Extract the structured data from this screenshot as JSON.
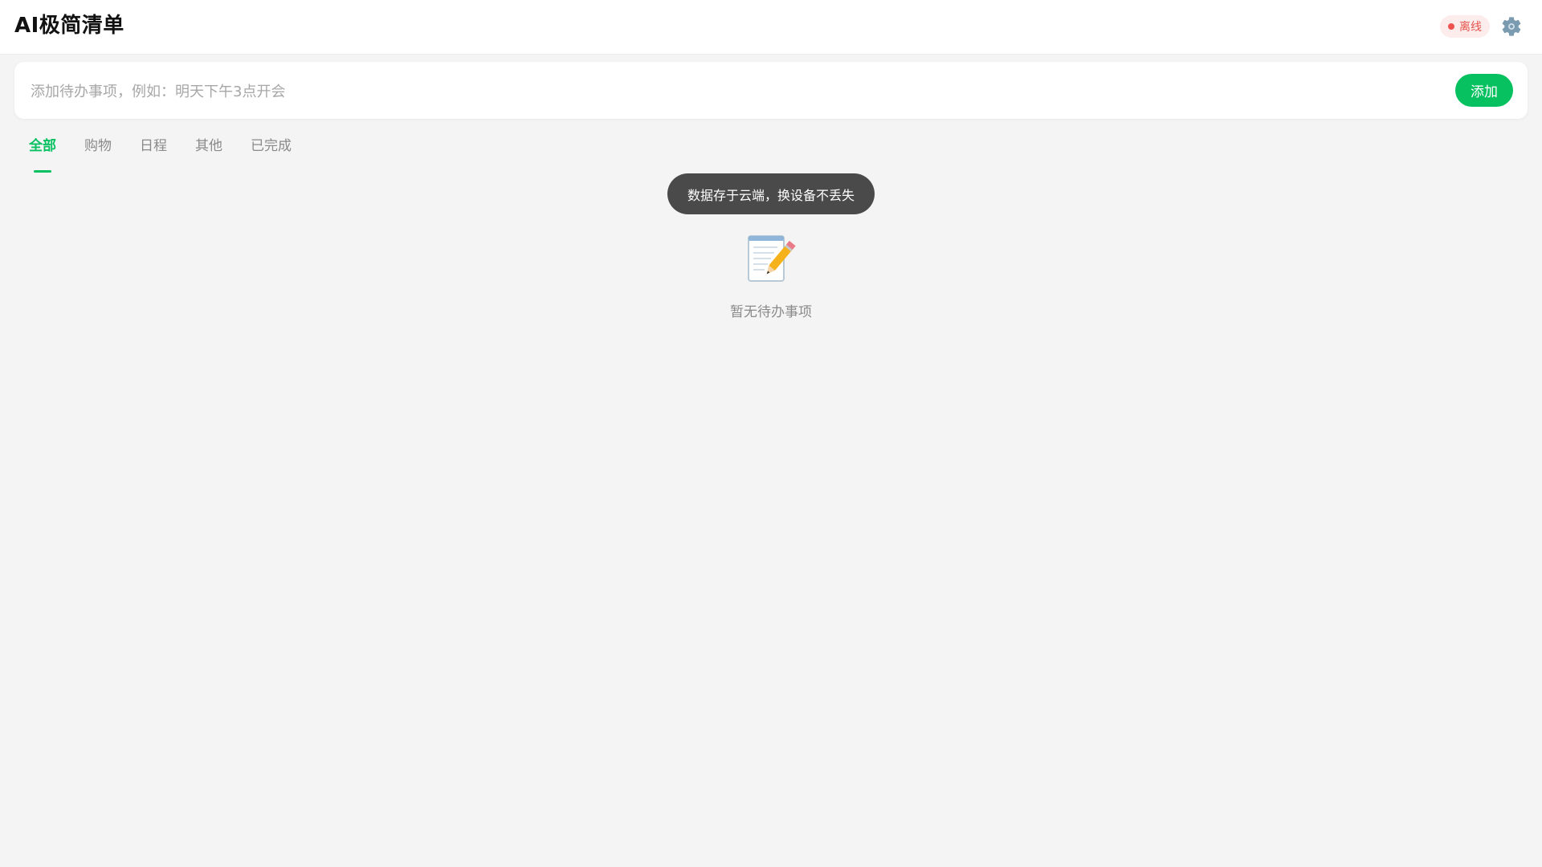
{
  "header": {
    "title": "AI极简清单",
    "status": "离线",
    "status_color": "#ef5350",
    "settings_icon": "gear-icon"
  },
  "input": {
    "placeholder": "添加待办事项，例如：明天下午3点开会",
    "value": "",
    "add_label": "添加"
  },
  "tabs": [
    {
      "label": "全部",
      "active": true
    },
    {
      "label": "购物",
      "active": false
    },
    {
      "label": "日程",
      "active": false
    },
    {
      "label": "其他",
      "active": false
    },
    {
      "label": "已完成",
      "active": false
    }
  ],
  "toast": {
    "text": "数据存于云端，换设备不丢失"
  },
  "empty_state": {
    "icon": "memo-pencil-icon",
    "text": "暂无待办事项"
  },
  "colors": {
    "accent": "#07c160",
    "background": "#f4f4f4",
    "toast_bg": "#4a4a4a"
  }
}
